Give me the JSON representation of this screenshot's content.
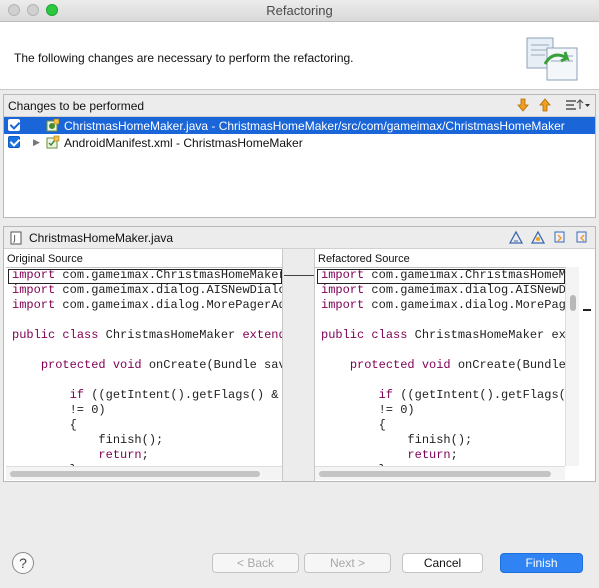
{
  "window": {
    "title": "Refactoring"
  },
  "header": {
    "message": "The following changes are necessary to perform the refactoring."
  },
  "changes": {
    "title": "Changes to be performed",
    "items": [
      {
        "label": "ChristmasHomeMaker.java - ChristmasHomeMaker/src/com/gameimax/ChristmasHomeMaker",
        "checked": true,
        "selected": true
      },
      {
        "label": "AndroidManifest.xml - ChristmasHomeMaker",
        "checked": true,
        "selected": false
      }
    ]
  },
  "compare": {
    "file": "ChristmasHomeMaker.java",
    "left_label": "Original Source",
    "right_label": "Refactored Source",
    "left_lines": [
      "import com.gameimax.ChristmasHomeMaker",
      "import com.gameimax.dialog.AISNewDialog",
      "import com.gameimax.dialog.MorePagerAda",
      "",
      "public class ChristmasHomeMaker extends",
      "",
      "    protected void onCreate(Bundle save",
      "",
      "        if ((getIntent().getFlags() &",
      "        != 0)",
      "        {",
      "            finish();",
      "            return;",
      "        }"
    ],
    "right_lines": [
      "import com.gameimax.ChristmasHomeMa",
      "import com.gameimax.dialog.AISNewDi",
      "import com.gameimax.dialog.MorePage",
      "",
      "public class ChristmasHomeMaker ext",
      "",
      "    protected void onCreate(Bundle",
      "",
      "        if ((getIntent().getFlags(",
      "        != 0)",
      "        {",
      "            finish();",
      "            return;",
      "        }"
    ]
  },
  "footer": {
    "help": "?",
    "back": "< Back",
    "next": "Next >",
    "cancel": "Cancel",
    "finish": "Finish"
  },
  "colors": {
    "accent": "#2f83f2",
    "selection": "#1a65d7",
    "keyword": "#7f0055"
  }
}
